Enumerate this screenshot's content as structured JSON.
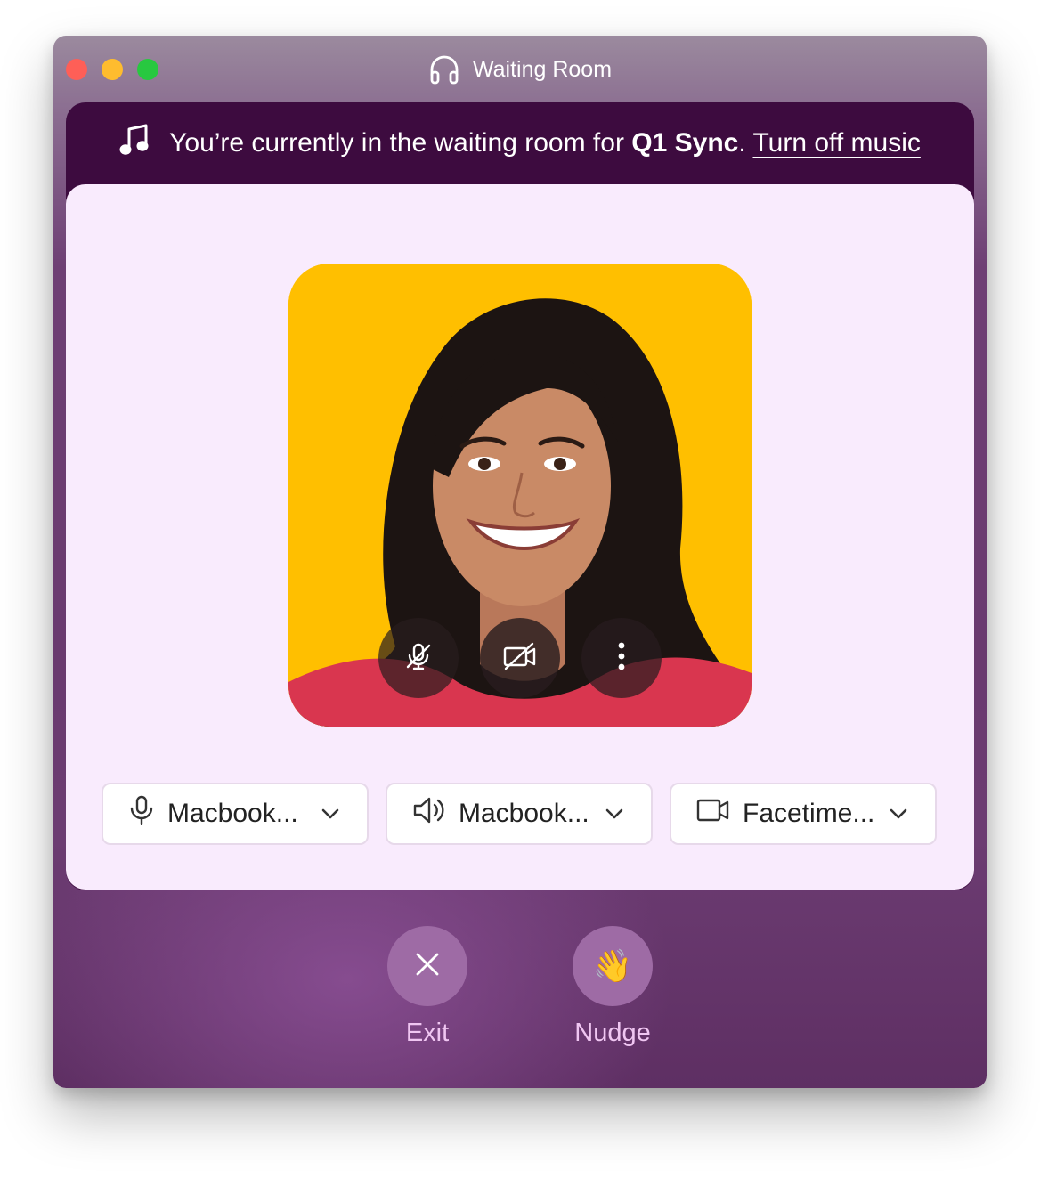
{
  "window": {
    "title": "Waiting Room"
  },
  "banner": {
    "prefix": "You’re currently in the waiting room for ",
    "meeting_name": "Q1 Sync",
    "suffix": ".",
    "link": "Turn off music"
  },
  "video_controls": {
    "mic_state": "muted",
    "camera_state": "off"
  },
  "devices": {
    "microphone": "Macbook...",
    "speaker": "Macbook...",
    "camera": "Facetime..."
  },
  "actions": {
    "exit_label": "Exit",
    "nudge_label": "Nudge",
    "nudge_emoji": "👋"
  },
  "colors": {
    "banner_bg": "#3d0b3f",
    "card_bg": "#f9ebfd",
    "video_bg": "#ffbf00",
    "action_button": "#9e6ba5",
    "action_label": "#f0c6f2"
  }
}
